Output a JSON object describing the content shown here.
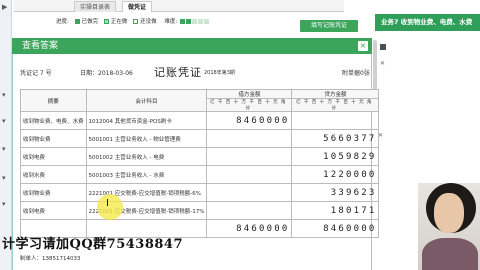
{
  "tabs": [
    {
      "label": "实操目录表",
      "active": false
    },
    {
      "label": "做凭证",
      "active": true
    }
  ],
  "progress": {
    "label": "进度:",
    "done": "已做完",
    "doing": "正在做",
    "pending": "还没做",
    "difficulty_label": "难度:",
    "difficulty_filled": 2,
    "difficulty_total": 5
  },
  "buttons": {
    "fill_voucher": "填写记账凭证"
  },
  "task_title": "业务7 收到物业费、电费、水费",
  "modal": {
    "title": "查看答案",
    "close": "×"
  },
  "voucher": {
    "number": "凭证记 7 号",
    "date": "日期：2018-03-06",
    "title": "记账凭证",
    "period": "2018年第3期",
    "attachments": "附单据0张",
    "headers": {
      "summary": "摘要",
      "account": "会计科目",
      "debit": "借方金额",
      "credit": "贷方金额",
      "digits": "亿千百十万千百十元角分"
    },
    "rows": [
      {
        "summary": "收到物业费、电费、水费",
        "account": "1012004 其他货币资金-POS刷卡",
        "debit": "8460000",
        "credit": ""
      },
      {
        "summary": "收到物业费",
        "account": "5001001 主营业务收入 - 物业管理费",
        "debit": "",
        "credit": "5660377"
      },
      {
        "summary": "收到电费",
        "account": "5001002 主营业务收入 - 电费",
        "debit": "",
        "credit": "1059829"
      },
      {
        "summary": "收到水费",
        "account": "5001003 主营业务收入 - 水费",
        "debit": "",
        "credit": "1220000"
      },
      {
        "summary": "收到物业费",
        "account": "2221001 应交税费-应交增值税-销项税额-6%",
        "debit": "",
        "credit": "339623"
      },
      {
        "summary": "收到电费",
        "account": "2221001 应交税费-应交增值税-销项税额-17%",
        "debit": "",
        "credit": "180171"
      }
    ],
    "total_debit": "8460000",
    "total_credit": "8460000",
    "maker": "制单人：13851714033"
  },
  "promo": "计学习请加QQ群75438847",
  "colors": {
    "accent": "#3aa55b",
    "task_bg": "#2e9e59",
    "done": "#3aa55b",
    "doing": "#a9d8b6",
    "pending": "#ffffff"
  },
  "icons": [
    "chevron-right-icon",
    "chevron-down-icon",
    "close-icon",
    "expand-icon"
  ]
}
